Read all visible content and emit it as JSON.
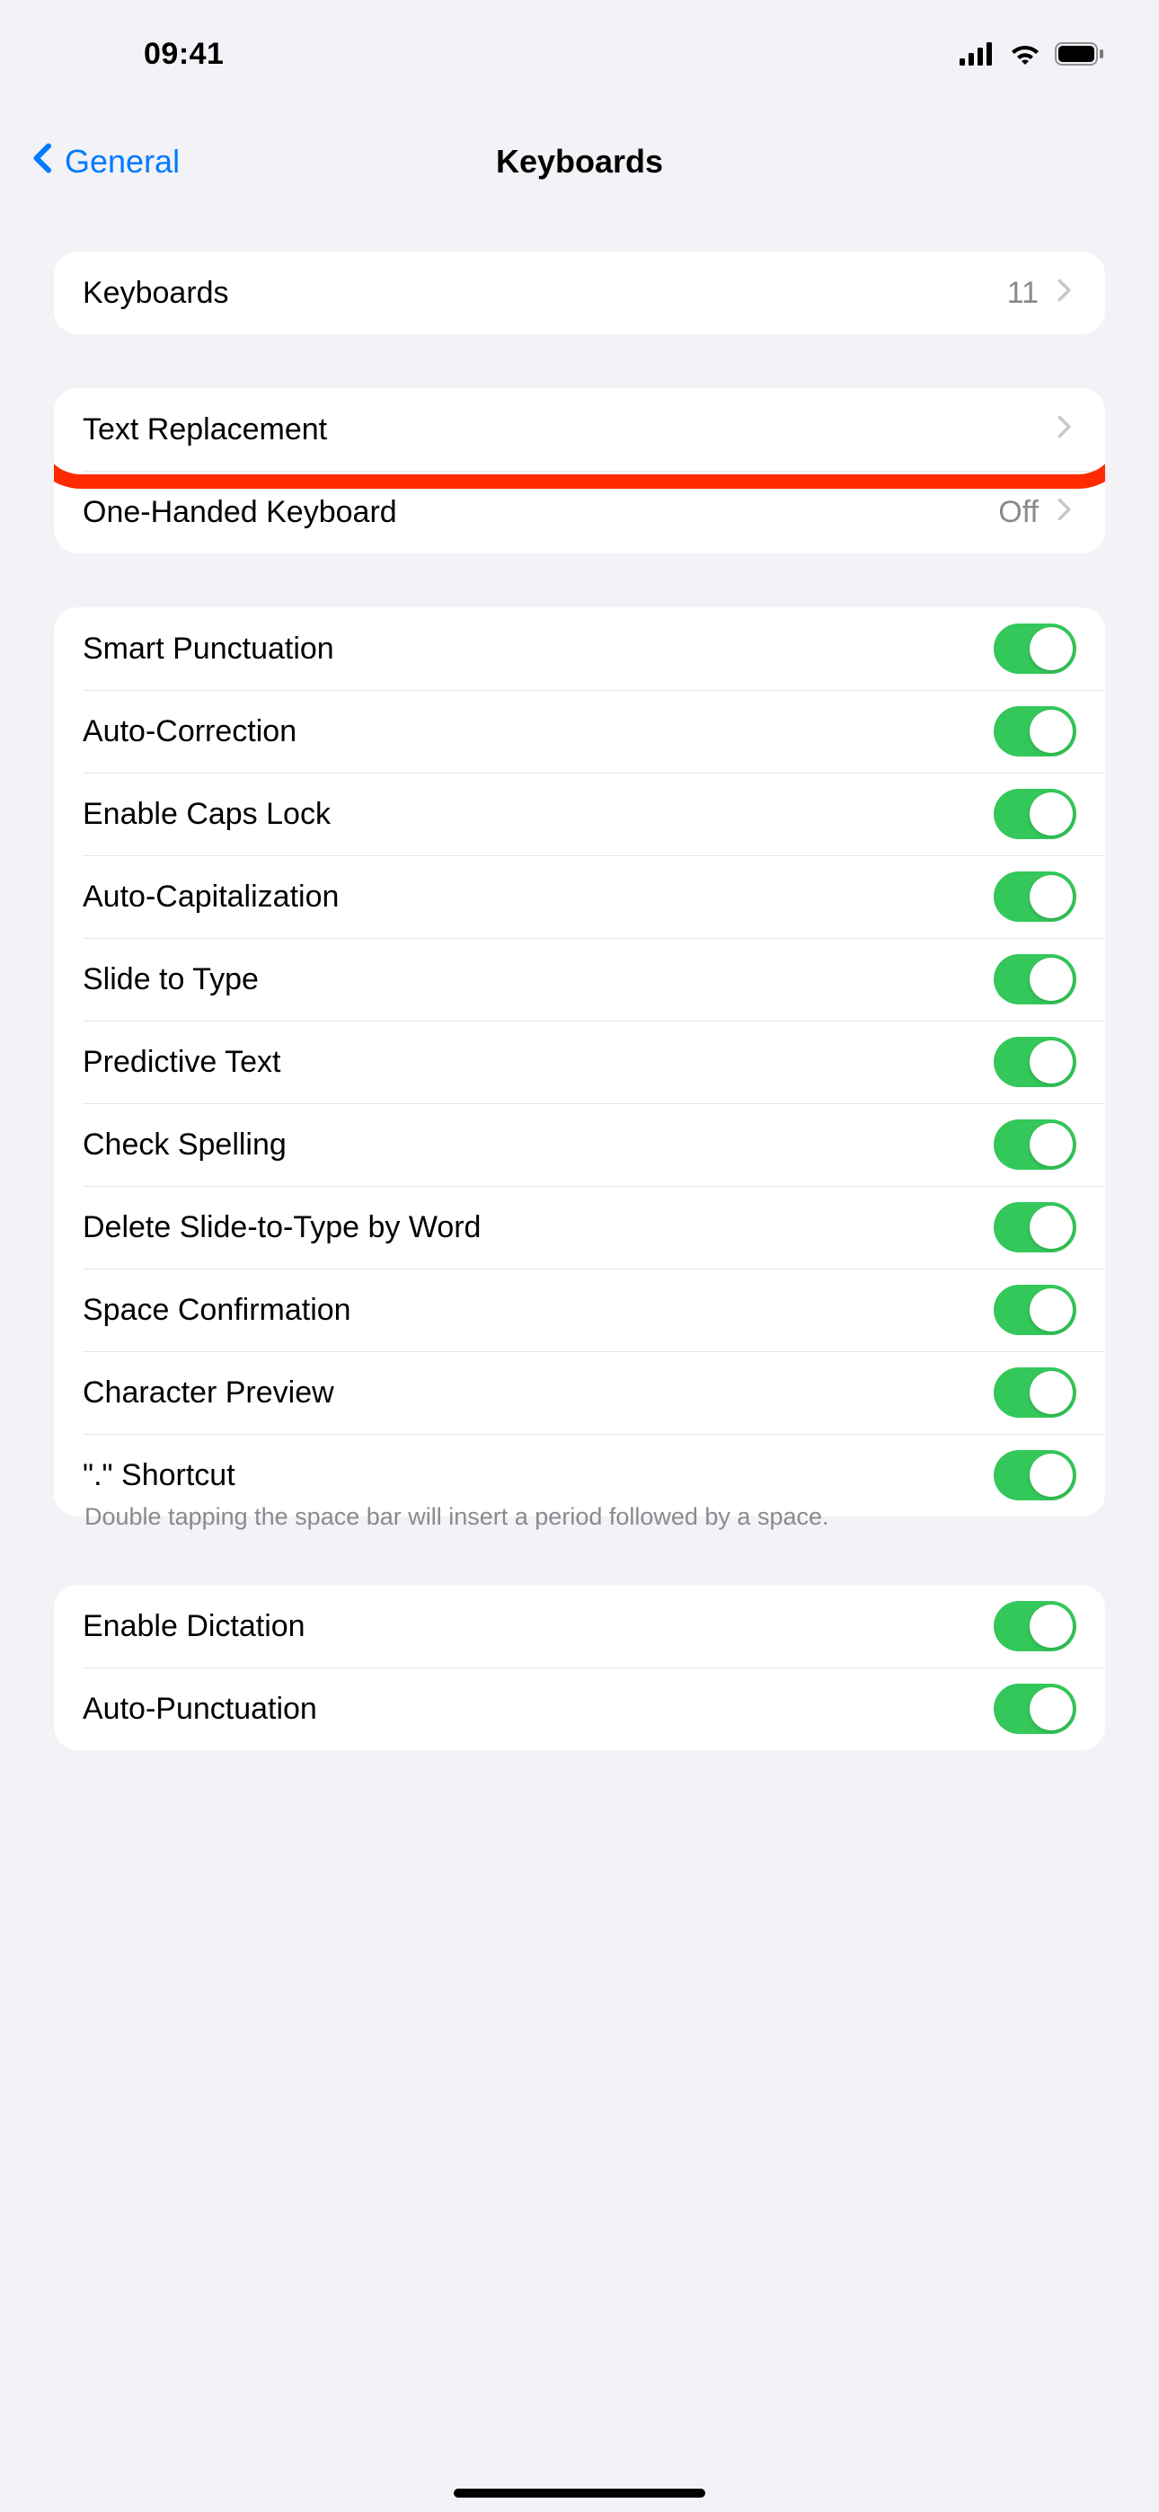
{
  "status": {
    "time": "09:41"
  },
  "nav": {
    "back_label": "General",
    "title": "Keyboards"
  },
  "group1": {
    "keyboards": {
      "label": "Keyboards",
      "value": "11"
    }
  },
  "group2": {
    "text_replacement": {
      "label": "Text Replacement"
    },
    "one_handed": {
      "label": "One-Handed Keyboard",
      "value": "Off"
    }
  },
  "toggles": {
    "smart_punctuation": {
      "label": "Smart Punctuation",
      "on": true
    },
    "auto_correction": {
      "label": "Auto-Correction",
      "on": true
    },
    "caps_lock": {
      "label": "Enable Caps Lock",
      "on": true
    },
    "auto_cap": {
      "label": "Auto-Capitalization",
      "on": true
    },
    "slide_type": {
      "label": "Slide to Type",
      "on": true
    },
    "predictive": {
      "label": "Predictive Text",
      "on": true
    },
    "spelling": {
      "label": "Check Spelling",
      "on": true
    },
    "delete_slide": {
      "label": "Delete Slide-to-Type by Word",
      "on": true
    },
    "space_conf": {
      "label": "Space Confirmation",
      "on": true
    },
    "char_preview": {
      "label": "Character Preview",
      "on": true
    },
    "period_shortcut": {
      "label": "\".\" Shortcut",
      "on": true
    }
  },
  "footer": {
    "period": "Double tapping the space bar will insert a period followed by a space."
  },
  "dictation": {
    "enable": {
      "label": "Enable Dictation",
      "on": true
    },
    "auto_punct": {
      "label": "Auto-Punctuation",
      "on": true
    }
  }
}
